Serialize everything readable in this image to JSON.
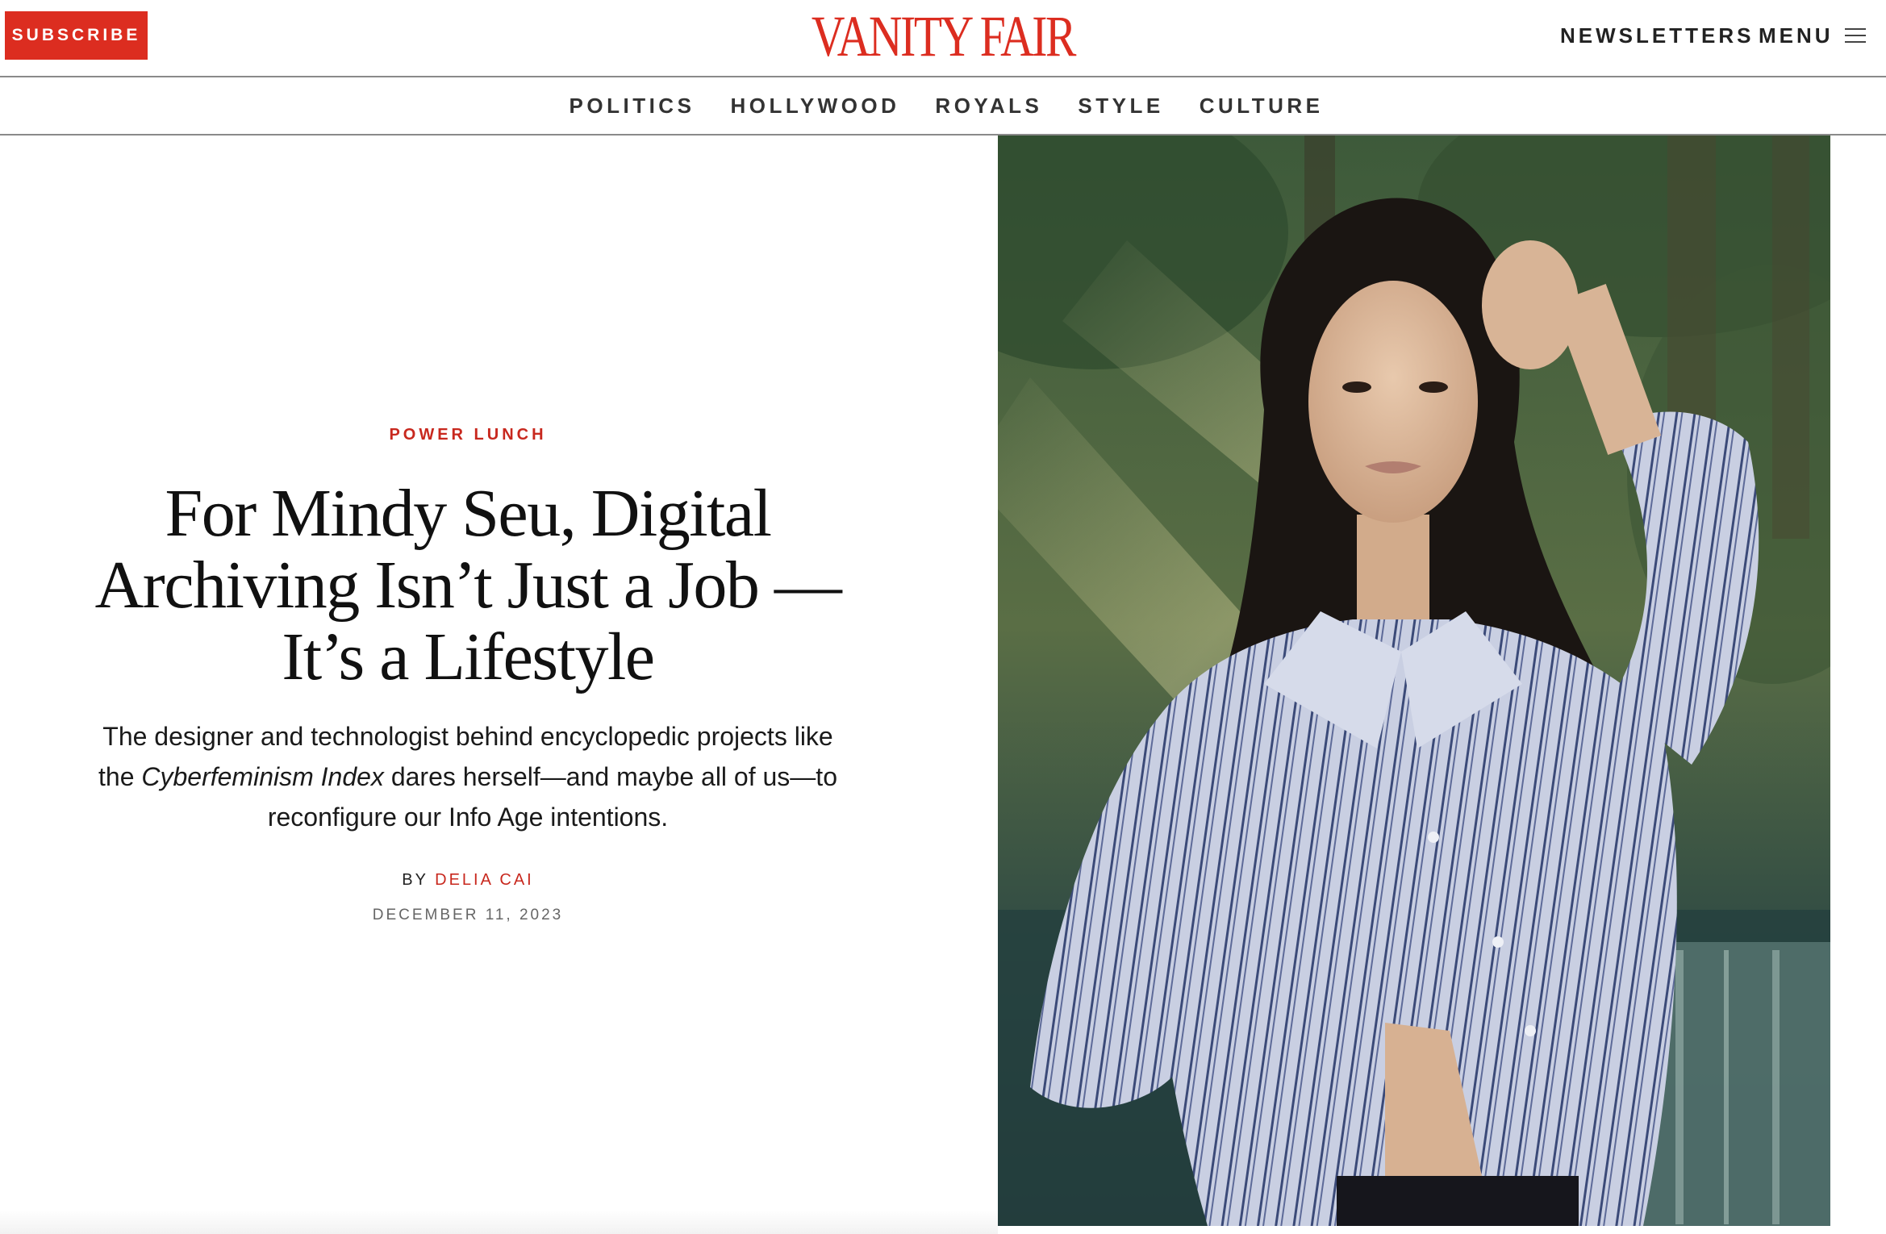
{
  "header": {
    "subscribe_label": "SUBSCRIBE",
    "logo_text": "VANITY FAIR",
    "newsletters_label": "NEWSLETTERS",
    "menu_label": "MENU",
    "menu_icon": "hamburger-icon"
  },
  "nav": {
    "items": [
      {
        "label": "POLITICS"
      },
      {
        "label": "HOLLYWOOD"
      },
      {
        "label": "ROYALS"
      },
      {
        "label": "STYLE"
      },
      {
        "label": "CULTURE"
      }
    ]
  },
  "article": {
    "rubric": "POWER LUNCH",
    "headline": "For Mindy Seu, Digital Archiving Isn’t Just a Job —It’s a Lifestyle",
    "dek_before": "The designer and technologist behind encyclopedic projects like the ",
    "dek_italic": "Cyberfeminism Index",
    "dek_after": " dares herself—and maybe all of us—to reconfigure our Info Age intentions.",
    "byline_prefix": "BY ",
    "author": "DELIA CAI",
    "date": "DECEMBER 11, 2023"
  },
  "colors": {
    "brand_red": "#dc2d20",
    "rubric_red": "#c8281e",
    "rule_gray": "#8a8a8a"
  }
}
